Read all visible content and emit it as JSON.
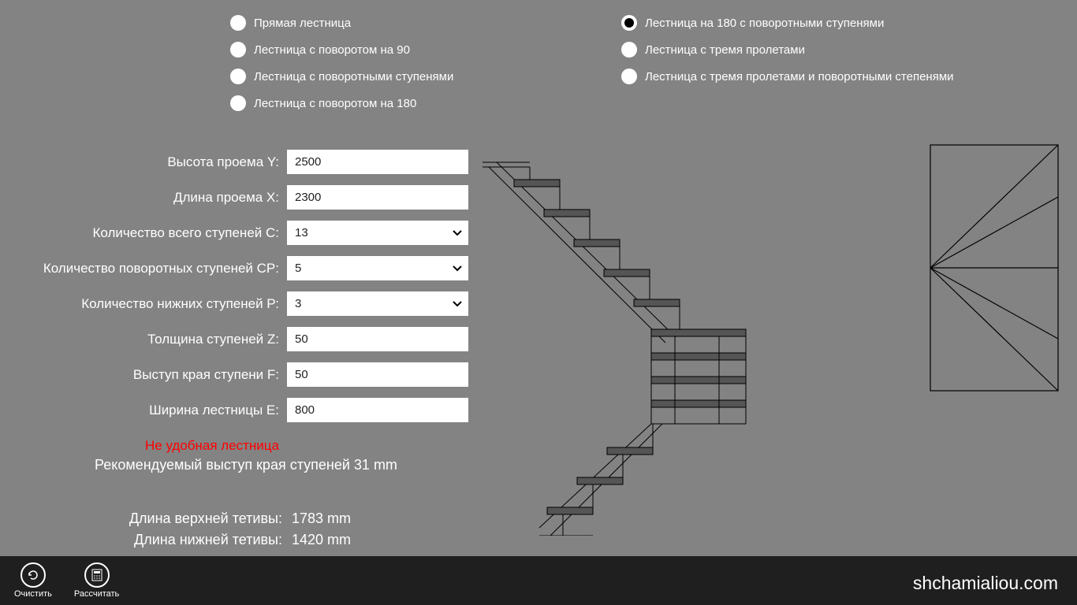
{
  "radios_left": [
    {
      "label": "Прямая лестница",
      "selected": false
    },
    {
      "label": "Лестница с поворотом на 90",
      "selected": false
    },
    {
      "label": "Лестница с поворотными ступенями",
      "selected": false
    },
    {
      "label": "Лестница с поворотом на 180",
      "selected": false
    }
  ],
  "radios_right": [
    {
      "label": "Лестница на 180 с поворотными ступенями",
      "selected": true
    },
    {
      "label": "Лестница с тремя пролетами",
      "selected": false
    },
    {
      "label": "Лестница с тремя пролетами и поворотными степенями",
      "selected": false
    }
  ],
  "form": {
    "height_y": {
      "label": "Высота проема Y:",
      "value": "2500"
    },
    "length_x": {
      "label": "Длина проема X:",
      "value": "2300"
    },
    "total_steps_c": {
      "label": "Количество всего ступеней С:",
      "value": "13"
    },
    "turn_steps_cp": {
      "label": "Количество поворотных ступеней СP:",
      "value": "5"
    },
    "lower_steps_p": {
      "label": "Количество нижних ступеней Р:",
      "value": "3"
    },
    "thickness_z": {
      "label": "Толщина ступеней Z:",
      "value": "50"
    },
    "overhang_f": {
      "label": "Выступ края ступени F:",
      "value": "50"
    },
    "width_e": {
      "label": "Ширина лестницы E:",
      "value": "800"
    }
  },
  "warning": "Не удобная лестница",
  "recommendation": "Рекомендуемый выступ края ступеней 31 mm",
  "results": {
    "upper_string": {
      "label": "Длина верхней тетивы:",
      "value": "1783 mm"
    },
    "lower_string": {
      "label": "Длина нижней тетивы:",
      "value": "1420 mm"
    }
  },
  "bottom_bar": {
    "clear": "Очистить",
    "calculate": "Рассчитать"
  },
  "brand": "shchamialiou.com"
}
